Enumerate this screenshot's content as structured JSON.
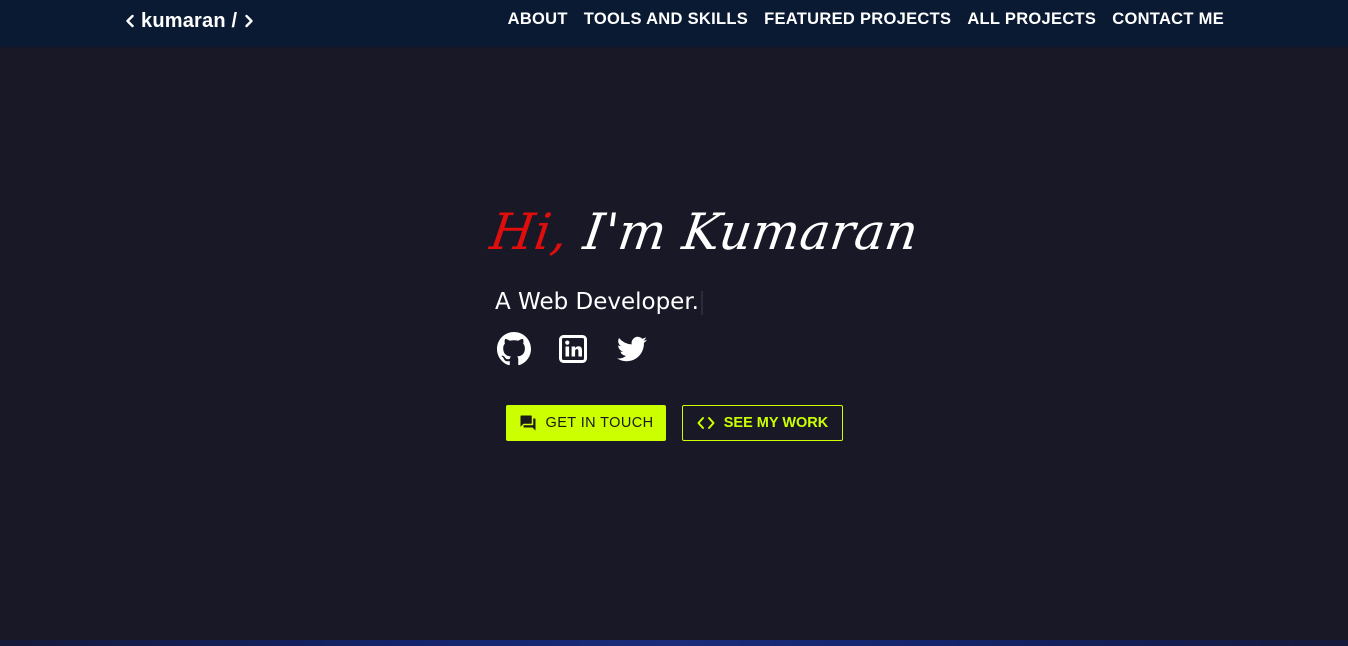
{
  "brand": {
    "name": "kumaran /",
    "chevron_left_icon": "chevron-left-icon",
    "chevron_right_icon": "chevron-right-icon"
  },
  "nav": {
    "items": [
      {
        "label": "ABOUT"
      },
      {
        "label": "TOOLS AND SKILLS"
      },
      {
        "label": "FEATURED PROJECTS"
      },
      {
        "label": "ALL PROJECTS"
      },
      {
        "label": "CONTACT ME"
      }
    ]
  },
  "hero": {
    "greeting_hi": "Hi,",
    "greeting_name": " I'm Kumaran",
    "subtitle": "A Web Developer.",
    "socials": [
      {
        "icon": "github-icon"
      },
      {
        "icon": "linkedin-icon"
      },
      {
        "icon": "twitter-icon"
      }
    ],
    "buttons": {
      "primary": {
        "label": "GET IN TOUCH",
        "icon": "chat-icon"
      },
      "secondary": {
        "label": "SEE MY WORK",
        "icon": "code-icon"
      }
    }
  },
  "colors": {
    "background": "#181826",
    "navbar": "#0b1a33",
    "accent": "#ccff00",
    "highlight_red": "#e00d0d",
    "text": "#ffffff"
  }
}
